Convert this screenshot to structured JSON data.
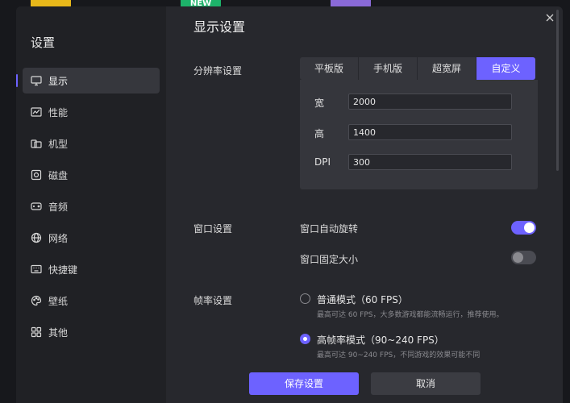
{
  "background": {
    "badge_new": "NEW"
  },
  "dialog": {
    "title": "设置",
    "sidebar": [
      {
        "label": "显示",
        "icon": "monitor-icon",
        "active": true
      },
      {
        "label": "性能",
        "icon": "performance-icon",
        "active": false
      },
      {
        "label": "机型",
        "icon": "device-icon",
        "active": false
      },
      {
        "label": "磁盘",
        "icon": "disk-icon",
        "active": false
      },
      {
        "label": "音频",
        "icon": "audio-icon",
        "active": false
      },
      {
        "label": "网络",
        "icon": "network-icon",
        "active": false
      },
      {
        "label": "快捷键",
        "icon": "keyboard-icon",
        "active": false
      },
      {
        "label": "壁纸",
        "icon": "wallpaper-icon",
        "active": false
      },
      {
        "label": "其他",
        "icon": "other-icon",
        "active": false
      }
    ],
    "content": {
      "section_title": "显示设置",
      "resolution": {
        "label": "分辨率设置",
        "tabs": [
          {
            "label": "平板版",
            "active": false
          },
          {
            "label": "手机版",
            "active": false
          },
          {
            "label": "超宽屏",
            "active": false
          },
          {
            "label": "自定义",
            "active": true
          }
        ],
        "width_label": "宽",
        "width_value": "2000",
        "height_label": "高",
        "height_value": "1400",
        "dpi_label": "DPI",
        "dpi_value": "300"
      },
      "window": {
        "label": "窗口设置",
        "auto_rotate_label": "窗口自动旋转",
        "auto_rotate_on": true,
        "fixed_size_label": "窗口固定大小",
        "fixed_size_on": false
      },
      "framerate": {
        "label": "帧率设置",
        "normal_title": "普通模式（60 FPS）",
        "normal_desc": "最高可达 60 FPS，大多数游戏都能流畅运行，推荐使用。",
        "normal_selected": false,
        "high_title": "高帧率模式（90~240 FPS）",
        "high_desc": "最高可达 90~240 FPS，不同游戏的效果可能不同",
        "high_selected": true
      }
    },
    "footer": {
      "save_label": "保存设置",
      "cancel_label": "取消"
    },
    "colors": {
      "accent": "#6d62ff",
      "panel": "#27282d",
      "sidebar": "#202125"
    }
  }
}
